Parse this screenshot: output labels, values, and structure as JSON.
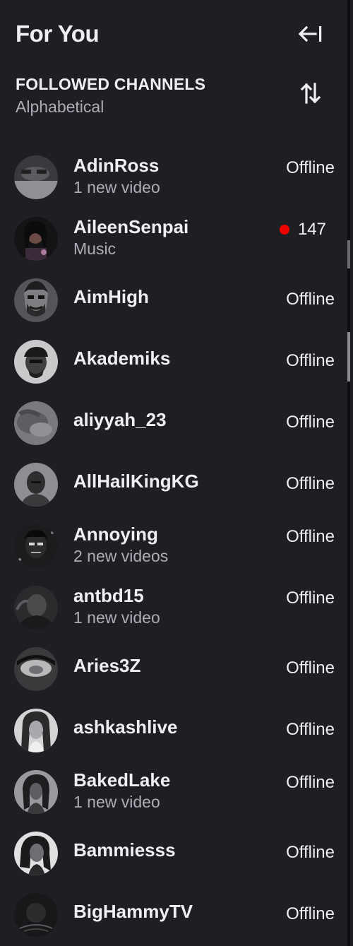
{
  "header": {
    "title": "For You",
    "collapse_icon": "collapse-left-icon"
  },
  "section": {
    "title": "FOLLOWED CHANNELS",
    "sort": "Alphabetical",
    "sort_icon": "sort-arrows-icon"
  },
  "colors": {
    "background": "#1f1f23",
    "text": "#efeff1",
    "muted": "#adadb8",
    "live": "#eb0400"
  },
  "channels": [
    {
      "name": "AdinRoss",
      "sub": "1 new video",
      "status": "Offline",
      "live": false
    },
    {
      "name": "AileenSenpai",
      "sub": "Music",
      "status": "147",
      "live": true
    },
    {
      "name": "AimHigh",
      "sub": "",
      "status": "Offline",
      "live": false
    },
    {
      "name": "Akademiks",
      "sub": "",
      "status": "Offline",
      "live": false
    },
    {
      "name": "aliyyah_23",
      "sub": "",
      "status": "Offline",
      "live": false
    },
    {
      "name": "AllHailKingKG",
      "sub": "",
      "status": "Offline",
      "live": false
    },
    {
      "name": "Annoying",
      "sub": "2 new videos",
      "status": "Offline",
      "live": false
    },
    {
      "name": "antbd15",
      "sub": "1 new video",
      "status": "Offline",
      "live": false
    },
    {
      "name": "Aries3Z",
      "sub": "",
      "status": "Offline",
      "live": false
    },
    {
      "name": "ashkashlive",
      "sub": "",
      "status": "Offline",
      "live": false
    },
    {
      "name": "BakedLake",
      "sub": "1 new video",
      "status": "Offline",
      "live": false
    },
    {
      "name": "Bammiesss",
      "sub": "",
      "status": "Offline",
      "live": false
    },
    {
      "name": "BigHammyTV",
      "sub": "",
      "status": "Offline",
      "live": false
    }
  ]
}
